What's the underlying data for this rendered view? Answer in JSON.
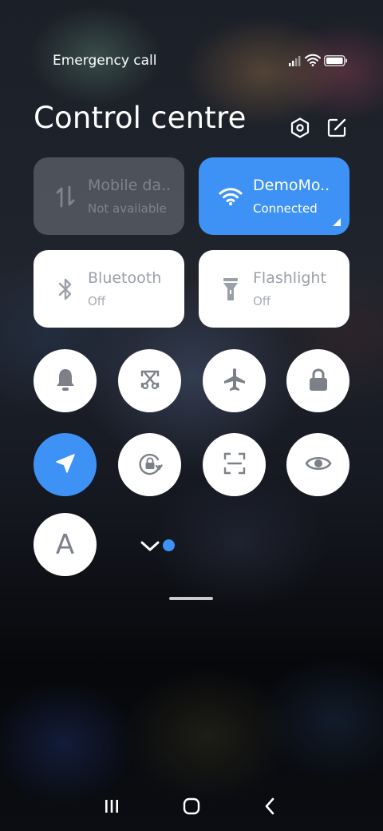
{
  "status_bar": {
    "carrier_text": "Emergency call",
    "signal_icon": "signal-icon",
    "wifi_icon": "wifi-status-icon",
    "battery_icon": "battery-icon"
  },
  "header": {
    "title": "Control centre",
    "settings_icon": "settings-hexagon-icon",
    "edit_icon": "edit-icon"
  },
  "tiles": [
    {
      "name": "Mobile da..",
      "status": "Not available",
      "icon": "mobile-data-icon",
      "state": "disabled"
    },
    {
      "name": "DemoMo..",
      "status": "Connected",
      "icon": "wifi-icon",
      "state": "active"
    },
    {
      "name": "Bluetooth",
      "status": "Off",
      "icon": "bluetooth-icon",
      "state": "off"
    },
    {
      "name": "Flashlight",
      "status": "Off",
      "icon": "flashlight-icon",
      "state": "off"
    }
  ],
  "toggles": [
    {
      "icon": "bell-icon",
      "active": false
    },
    {
      "icon": "screenshot-icon",
      "active": false
    },
    {
      "icon": "airplane-icon",
      "active": false
    },
    {
      "icon": "lock-icon",
      "active": false
    },
    {
      "icon": "location-icon",
      "active": true
    },
    {
      "icon": "rotation-lock-icon",
      "active": false
    },
    {
      "icon": "scan-icon",
      "active": false
    },
    {
      "icon": "eye-icon",
      "active": false
    },
    {
      "icon": "font-size-icon",
      "label": "A",
      "active": false
    }
  ],
  "pager": {
    "icon": "chevron-down-icon",
    "page_indicator": "blue-dot"
  },
  "colors": {
    "accent": "#3f92f5",
    "tile_white": "#ffffff",
    "icon_gray": "#7c8088"
  },
  "nav_bar": {
    "recents_icon": "recents-icon",
    "home_icon": "home-icon",
    "back_icon": "back-icon"
  }
}
